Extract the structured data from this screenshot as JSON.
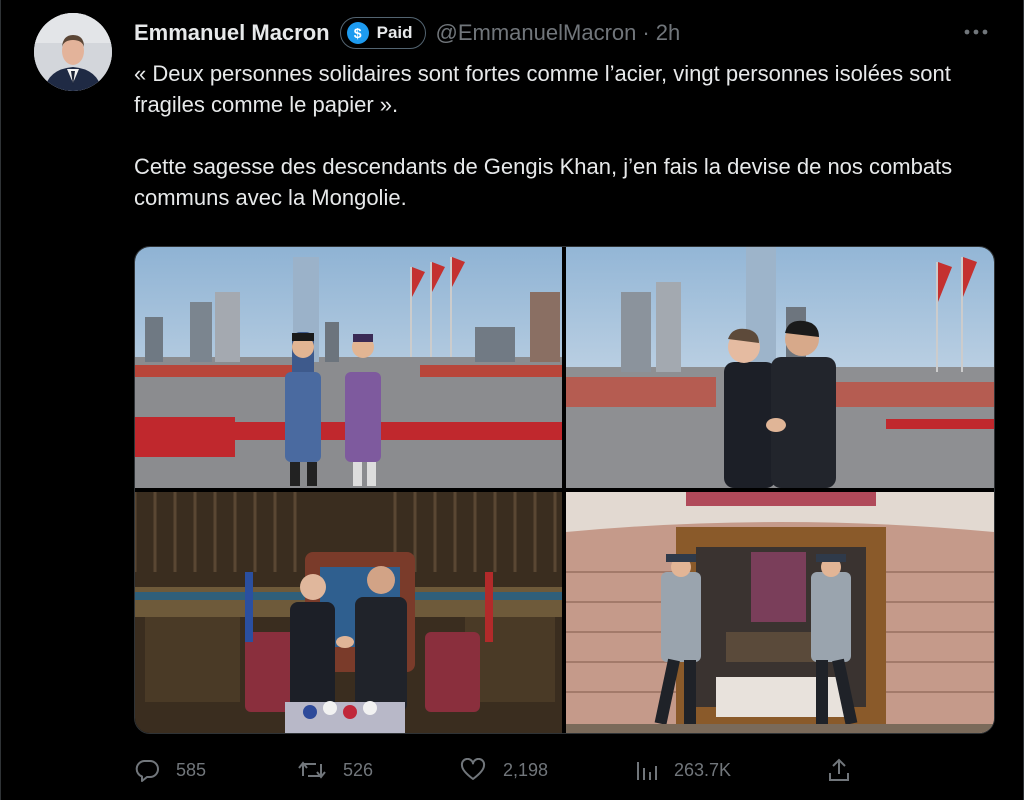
{
  "author": {
    "name": "Emmanuel Macron",
    "badge_label": "Paid",
    "badge_icon": "dollar-coin-icon",
    "handle": "@EmmanuelMacron",
    "separator": "·",
    "time": "2h"
  },
  "tweet": {
    "paragraphs": [
      "« Deux personnes solidaires sont fortes comme l’acier, vingt personnes isolées sont fragiles comme le papier ».",
      "Cette sagesse des descendants de Gengis Khan, j’en fais la devise de nos combats communs avec la Mongolie."
    ]
  },
  "actions": {
    "reply": {
      "icon": "reply-icon",
      "count": "585"
    },
    "retweet": {
      "icon": "retweet-icon",
      "count": "526"
    },
    "like": {
      "icon": "heart-icon",
      "count": "2,198"
    },
    "views": {
      "icon": "views-chart-icon",
      "count": "263.7K"
    },
    "share": {
      "icon": "share-icon"
    }
  },
  "colors": {
    "background": "#000000",
    "text": "#e7e9ea",
    "muted": "#71767b",
    "border": "#2f3336",
    "accent": "#1d9bf0"
  }
}
